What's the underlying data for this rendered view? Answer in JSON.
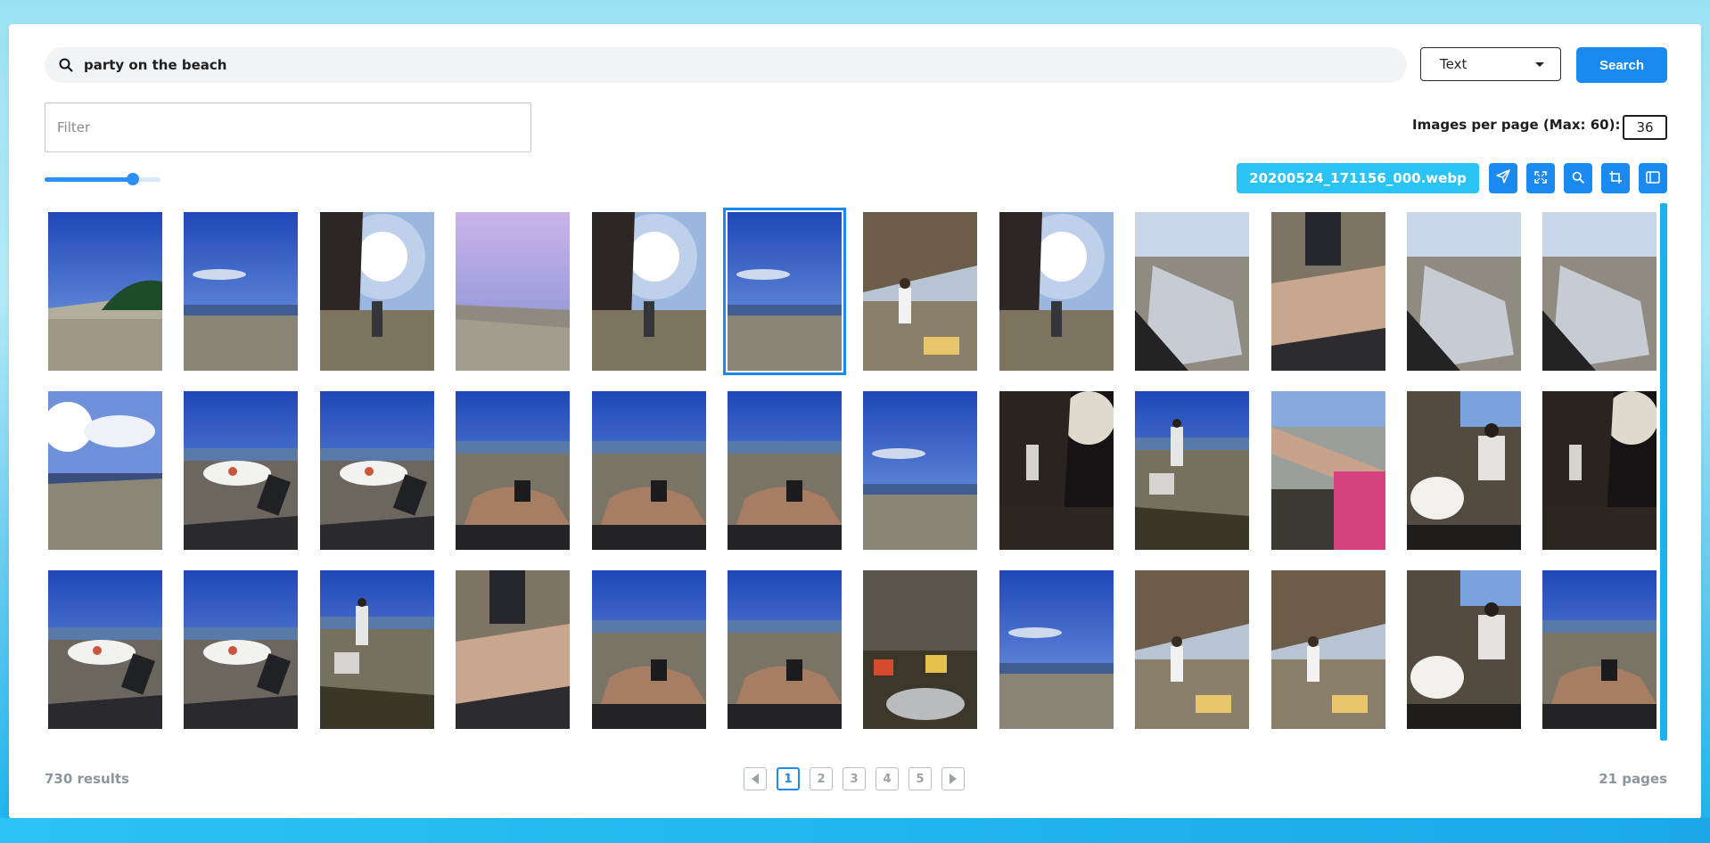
{
  "search": {
    "query": "party on the beach",
    "mode": "Text",
    "button_label": "Search"
  },
  "filter": {
    "placeholder": "Filter",
    "value": ""
  },
  "per_page": {
    "label": "Images per page (Max: 60):",
    "value": "36"
  },
  "thumbnail_size_slider": {
    "value_fraction": 0.76
  },
  "selected_image": {
    "filename": "20200524_171156_000.webp"
  },
  "toolbar": [
    {
      "name": "send-button",
      "icon": "send-icon"
    },
    {
      "name": "fullscreen-button",
      "icon": "expand-icon"
    },
    {
      "name": "zoom-button",
      "icon": "search-icon"
    },
    {
      "name": "crop-button",
      "icon": "crop-icon"
    },
    {
      "name": "panel-toggle-button",
      "icon": "panel-icon"
    }
  ],
  "grid": {
    "columns": 12,
    "rows": 3,
    "selected_index": 5,
    "thumbnails": [
      {
        "scene": "palms-beach"
      },
      {
        "scene": "blue-sky-beach"
      },
      {
        "scene": "cliff-sun"
      },
      {
        "scene": "pale-sky-beach"
      },
      {
        "scene": "cliff-sun"
      },
      {
        "scene": "blue-sky-beach"
      },
      {
        "scene": "cliff-person"
      },
      {
        "scene": "cliff-sun"
      },
      {
        "scene": "leg-closeup"
      },
      {
        "scene": "arm-closeup"
      },
      {
        "scene": "leg-closeup"
      },
      {
        "scene": "leg-closeup"
      },
      {
        "scene": "sun-clouds"
      },
      {
        "scene": "plate-beach"
      },
      {
        "scene": "plate-beach"
      },
      {
        "scene": "hand-beach"
      },
      {
        "scene": "hand-beach"
      },
      {
        "scene": "hand-beach"
      },
      {
        "scene": "blue-sky-beach"
      },
      {
        "scene": "dark-cliff"
      },
      {
        "scene": "people-beach"
      },
      {
        "scene": "arm-pink"
      },
      {
        "scene": "people-plate"
      },
      {
        "scene": "dark-cliff"
      },
      {
        "scene": "plate-beach"
      },
      {
        "scene": "plate-beach"
      },
      {
        "scene": "people-beach"
      },
      {
        "scene": "arm-closeup"
      },
      {
        "scene": "hand-beach"
      },
      {
        "scene": "hand-beach"
      },
      {
        "scene": "rocks-picnic"
      },
      {
        "scene": "blue-sky-beach"
      },
      {
        "scene": "cliff-person"
      },
      {
        "scene": "cliff-person"
      },
      {
        "scene": "people-plate"
      },
      {
        "scene": "hand-beach"
      }
    ]
  },
  "footer": {
    "results": "730 results",
    "pages": "21 pages",
    "current_page": "1",
    "page_buttons": [
      "1",
      "2",
      "3",
      "4",
      "5"
    ]
  },
  "colors": {
    "accent": "#1a8af1",
    "filename_pill": "#29c3f4",
    "muted_text": "#8e959e"
  }
}
